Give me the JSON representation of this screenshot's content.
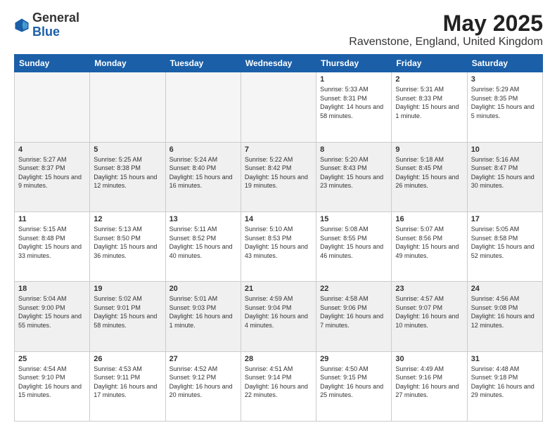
{
  "header": {
    "logo_general": "General",
    "logo_blue": "Blue",
    "title": "May 2025",
    "subtitle": "Ravenstone, England, United Kingdom"
  },
  "days_of_week": [
    "Sunday",
    "Monday",
    "Tuesday",
    "Wednesday",
    "Thursday",
    "Friday",
    "Saturday"
  ],
  "weeks": [
    {
      "shaded": false,
      "days": [
        {
          "num": "",
          "empty": true
        },
        {
          "num": "",
          "empty": true
        },
        {
          "num": "",
          "empty": true
        },
        {
          "num": "",
          "empty": true
        },
        {
          "num": "1",
          "sunrise": "5:33 AM",
          "sunset": "8:31 PM",
          "daylight": "14 hours and 58 minutes."
        },
        {
          "num": "2",
          "sunrise": "5:31 AM",
          "sunset": "8:33 PM",
          "daylight": "15 hours and 1 minute."
        },
        {
          "num": "3",
          "sunrise": "5:29 AM",
          "sunset": "8:35 PM",
          "daylight": "15 hours and 5 minutes."
        }
      ]
    },
    {
      "shaded": true,
      "days": [
        {
          "num": "4",
          "sunrise": "5:27 AM",
          "sunset": "8:37 PM",
          "daylight": "15 hours and 9 minutes."
        },
        {
          "num": "5",
          "sunrise": "5:25 AM",
          "sunset": "8:38 PM",
          "daylight": "15 hours and 12 minutes."
        },
        {
          "num": "6",
          "sunrise": "5:24 AM",
          "sunset": "8:40 PM",
          "daylight": "15 hours and 16 minutes."
        },
        {
          "num": "7",
          "sunrise": "5:22 AM",
          "sunset": "8:42 PM",
          "daylight": "15 hours and 19 minutes."
        },
        {
          "num": "8",
          "sunrise": "5:20 AM",
          "sunset": "8:43 PM",
          "daylight": "15 hours and 23 minutes."
        },
        {
          "num": "9",
          "sunrise": "5:18 AM",
          "sunset": "8:45 PM",
          "daylight": "15 hours and 26 minutes."
        },
        {
          "num": "10",
          "sunrise": "5:16 AM",
          "sunset": "8:47 PM",
          "daylight": "15 hours and 30 minutes."
        }
      ]
    },
    {
      "shaded": false,
      "days": [
        {
          "num": "11",
          "sunrise": "5:15 AM",
          "sunset": "8:48 PM",
          "daylight": "15 hours and 33 minutes."
        },
        {
          "num": "12",
          "sunrise": "5:13 AM",
          "sunset": "8:50 PM",
          "daylight": "15 hours and 36 minutes."
        },
        {
          "num": "13",
          "sunrise": "5:11 AM",
          "sunset": "8:52 PM",
          "daylight": "15 hours and 40 minutes."
        },
        {
          "num": "14",
          "sunrise": "5:10 AM",
          "sunset": "8:53 PM",
          "daylight": "15 hours and 43 minutes."
        },
        {
          "num": "15",
          "sunrise": "5:08 AM",
          "sunset": "8:55 PM",
          "daylight": "15 hours and 46 minutes."
        },
        {
          "num": "16",
          "sunrise": "5:07 AM",
          "sunset": "8:56 PM",
          "daylight": "15 hours and 49 minutes."
        },
        {
          "num": "17",
          "sunrise": "5:05 AM",
          "sunset": "8:58 PM",
          "daylight": "15 hours and 52 minutes."
        }
      ]
    },
    {
      "shaded": true,
      "days": [
        {
          "num": "18",
          "sunrise": "5:04 AM",
          "sunset": "9:00 PM",
          "daylight": "15 hours and 55 minutes."
        },
        {
          "num": "19",
          "sunrise": "5:02 AM",
          "sunset": "9:01 PM",
          "daylight": "15 hours and 58 minutes."
        },
        {
          "num": "20",
          "sunrise": "5:01 AM",
          "sunset": "9:03 PM",
          "daylight": "16 hours and 1 minute."
        },
        {
          "num": "21",
          "sunrise": "4:59 AM",
          "sunset": "9:04 PM",
          "daylight": "16 hours and 4 minutes."
        },
        {
          "num": "22",
          "sunrise": "4:58 AM",
          "sunset": "9:06 PM",
          "daylight": "16 hours and 7 minutes."
        },
        {
          "num": "23",
          "sunrise": "4:57 AM",
          "sunset": "9:07 PM",
          "daylight": "16 hours and 10 minutes."
        },
        {
          "num": "24",
          "sunrise": "4:56 AM",
          "sunset": "9:08 PM",
          "daylight": "16 hours and 12 minutes."
        }
      ]
    },
    {
      "shaded": false,
      "days": [
        {
          "num": "25",
          "sunrise": "4:54 AM",
          "sunset": "9:10 PM",
          "daylight": "16 hours and 15 minutes."
        },
        {
          "num": "26",
          "sunrise": "4:53 AM",
          "sunset": "9:11 PM",
          "daylight": "16 hours and 17 minutes."
        },
        {
          "num": "27",
          "sunrise": "4:52 AM",
          "sunset": "9:12 PM",
          "daylight": "16 hours and 20 minutes."
        },
        {
          "num": "28",
          "sunrise": "4:51 AM",
          "sunset": "9:14 PM",
          "daylight": "16 hours and 22 minutes."
        },
        {
          "num": "29",
          "sunrise": "4:50 AM",
          "sunset": "9:15 PM",
          "daylight": "16 hours and 25 minutes."
        },
        {
          "num": "30",
          "sunrise": "4:49 AM",
          "sunset": "9:16 PM",
          "daylight": "16 hours and 27 minutes."
        },
        {
          "num": "31",
          "sunrise": "4:48 AM",
          "sunset": "9:18 PM",
          "daylight": "16 hours and 29 minutes."
        }
      ]
    }
  ]
}
